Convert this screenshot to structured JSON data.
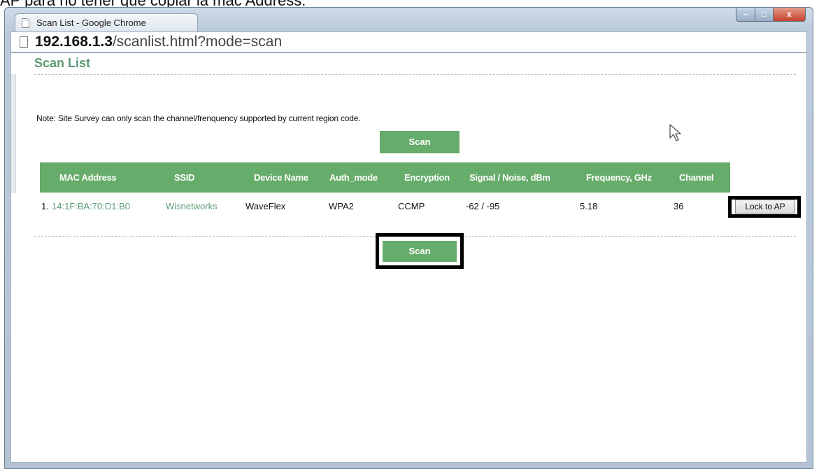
{
  "overlay_caption": "AP para no tener que copiar la mac Address.",
  "window": {
    "tab_title": "Scan List - Google Chrome",
    "controls": {
      "minimize": "–",
      "maximize": "□",
      "close": "x"
    }
  },
  "address_bar": {
    "host": "192.168.1.3",
    "path": "/scanlist.html?mode=scan"
  },
  "page": {
    "title": "Scan List",
    "note": "Note: Site Survey can only scan the channel/frenquency supported by current region code.",
    "scan_button_top": "Scan",
    "scan_button_bottom": "Scan",
    "lock_button": "Lock to AP"
  },
  "table": {
    "headers": {
      "mac": "MAC Address",
      "ssid": "SSID",
      "device": "Device Name",
      "auth": "Auth_mode",
      "encryption": "Encryption",
      "signal": "Signal / Noise, dBm",
      "frequency": "Frequency, GHz",
      "channel": "Channel"
    },
    "rows": [
      {
        "index": "1.",
        "mac": "14:1F:BA:70:D1:B0",
        "ssid": "Wisnetworks",
        "device": "WaveFlex",
        "auth": "WPA2",
        "encryption": "CCMP",
        "signal": "-62 / -95",
        "frequency": "5.18",
        "channel": "36"
      }
    ]
  },
  "colors": {
    "accent_green": "#66ac6a",
    "link_green": "#5d9a76",
    "highlight_frame": "#000000"
  }
}
